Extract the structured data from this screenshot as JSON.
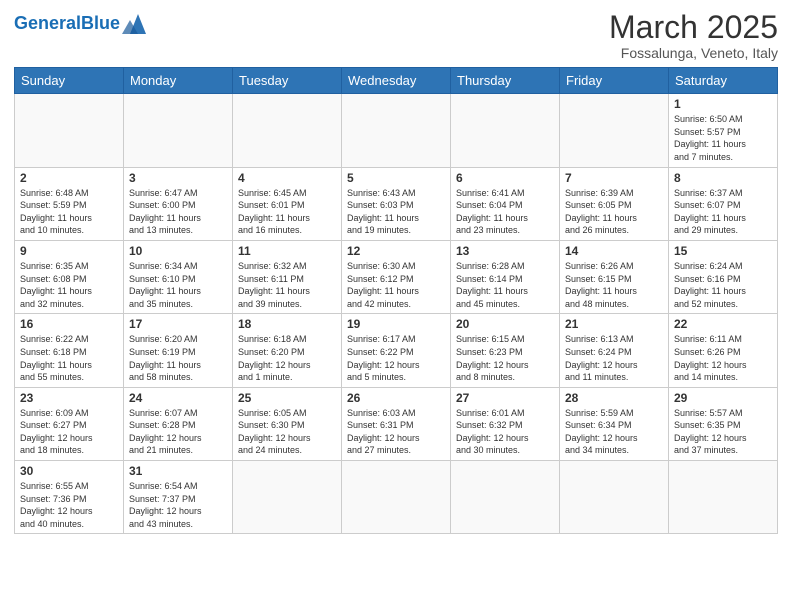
{
  "header": {
    "logo_general": "General",
    "logo_blue": "Blue",
    "month_title": "March 2025",
    "subtitle": "Fossalunga, Veneto, Italy"
  },
  "weekdays": [
    "Sunday",
    "Monday",
    "Tuesday",
    "Wednesday",
    "Thursday",
    "Friday",
    "Saturday"
  ],
  "weeks": [
    [
      {
        "day": "",
        "info": ""
      },
      {
        "day": "",
        "info": ""
      },
      {
        "day": "",
        "info": ""
      },
      {
        "day": "",
        "info": ""
      },
      {
        "day": "",
        "info": ""
      },
      {
        "day": "",
        "info": ""
      },
      {
        "day": "1",
        "info": "Sunrise: 6:50 AM\nSunset: 5:57 PM\nDaylight: 11 hours\nand 7 minutes."
      }
    ],
    [
      {
        "day": "2",
        "info": "Sunrise: 6:48 AM\nSunset: 5:59 PM\nDaylight: 11 hours\nand 10 minutes."
      },
      {
        "day": "3",
        "info": "Sunrise: 6:47 AM\nSunset: 6:00 PM\nDaylight: 11 hours\nand 13 minutes."
      },
      {
        "day": "4",
        "info": "Sunrise: 6:45 AM\nSunset: 6:01 PM\nDaylight: 11 hours\nand 16 minutes."
      },
      {
        "day": "5",
        "info": "Sunrise: 6:43 AM\nSunset: 6:03 PM\nDaylight: 11 hours\nand 19 minutes."
      },
      {
        "day": "6",
        "info": "Sunrise: 6:41 AM\nSunset: 6:04 PM\nDaylight: 11 hours\nand 23 minutes."
      },
      {
        "day": "7",
        "info": "Sunrise: 6:39 AM\nSunset: 6:05 PM\nDaylight: 11 hours\nand 26 minutes."
      },
      {
        "day": "8",
        "info": "Sunrise: 6:37 AM\nSunset: 6:07 PM\nDaylight: 11 hours\nand 29 minutes."
      }
    ],
    [
      {
        "day": "9",
        "info": "Sunrise: 6:35 AM\nSunset: 6:08 PM\nDaylight: 11 hours\nand 32 minutes."
      },
      {
        "day": "10",
        "info": "Sunrise: 6:34 AM\nSunset: 6:10 PM\nDaylight: 11 hours\nand 35 minutes."
      },
      {
        "day": "11",
        "info": "Sunrise: 6:32 AM\nSunset: 6:11 PM\nDaylight: 11 hours\nand 39 minutes."
      },
      {
        "day": "12",
        "info": "Sunrise: 6:30 AM\nSunset: 6:12 PM\nDaylight: 11 hours\nand 42 minutes."
      },
      {
        "day": "13",
        "info": "Sunrise: 6:28 AM\nSunset: 6:14 PM\nDaylight: 11 hours\nand 45 minutes."
      },
      {
        "day": "14",
        "info": "Sunrise: 6:26 AM\nSunset: 6:15 PM\nDaylight: 11 hours\nand 48 minutes."
      },
      {
        "day": "15",
        "info": "Sunrise: 6:24 AM\nSunset: 6:16 PM\nDaylight: 11 hours\nand 52 minutes."
      }
    ],
    [
      {
        "day": "16",
        "info": "Sunrise: 6:22 AM\nSunset: 6:18 PM\nDaylight: 11 hours\nand 55 minutes."
      },
      {
        "day": "17",
        "info": "Sunrise: 6:20 AM\nSunset: 6:19 PM\nDaylight: 11 hours\nand 58 minutes."
      },
      {
        "day": "18",
        "info": "Sunrise: 6:18 AM\nSunset: 6:20 PM\nDaylight: 12 hours\nand 1 minute."
      },
      {
        "day": "19",
        "info": "Sunrise: 6:17 AM\nSunset: 6:22 PM\nDaylight: 12 hours\nand 5 minutes."
      },
      {
        "day": "20",
        "info": "Sunrise: 6:15 AM\nSunset: 6:23 PM\nDaylight: 12 hours\nand 8 minutes."
      },
      {
        "day": "21",
        "info": "Sunrise: 6:13 AM\nSunset: 6:24 PM\nDaylight: 12 hours\nand 11 minutes."
      },
      {
        "day": "22",
        "info": "Sunrise: 6:11 AM\nSunset: 6:26 PM\nDaylight: 12 hours\nand 14 minutes."
      }
    ],
    [
      {
        "day": "23",
        "info": "Sunrise: 6:09 AM\nSunset: 6:27 PM\nDaylight: 12 hours\nand 18 minutes."
      },
      {
        "day": "24",
        "info": "Sunrise: 6:07 AM\nSunset: 6:28 PM\nDaylight: 12 hours\nand 21 minutes."
      },
      {
        "day": "25",
        "info": "Sunrise: 6:05 AM\nSunset: 6:30 PM\nDaylight: 12 hours\nand 24 minutes."
      },
      {
        "day": "26",
        "info": "Sunrise: 6:03 AM\nSunset: 6:31 PM\nDaylight: 12 hours\nand 27 minutes."
      },
      {
        "day": "27",
        "info": "Sunrise: 6:01 AM\nSunset: 6:32 PM\nDaylight: 12 hours\nand 30 minutes."
      },
      {
        "day": "28",
        "info": "Sunrise: 5:59 AM\nSunset: 6:34 PM\nDaylight: 12 hours\nand 34 minutes."
      },
      {
        "day": "29",
        "info": "Sunrise: 5:57 AM\nSunset: 6:35 PM\nDaylight: 12 hours\nand 37 minutes."
      }
    ],
    [
      {
        "day": "30",
        "info": "Sunrise: 6:55 AM\nSunset: 7:36 PM\nDaylight: 12 hours\nand 40 minutes."
      },
      {
        "day": "31",
        "info": "Sunrise: 6:54 AM\nSunset: 7:37 PM\nDaylight: 12 hours\nand 43 minutes."
      },
      {
        "day": "",
        "info": ""
      },
      {
        "day": "",
        "info": ""
      },
      {
        "day": "",
        "info": ""
      },
      {
        "day": "",
        "info": ""
      },
      {
        "day": "",
        "info": ""
      }
    ]
  ]
}
